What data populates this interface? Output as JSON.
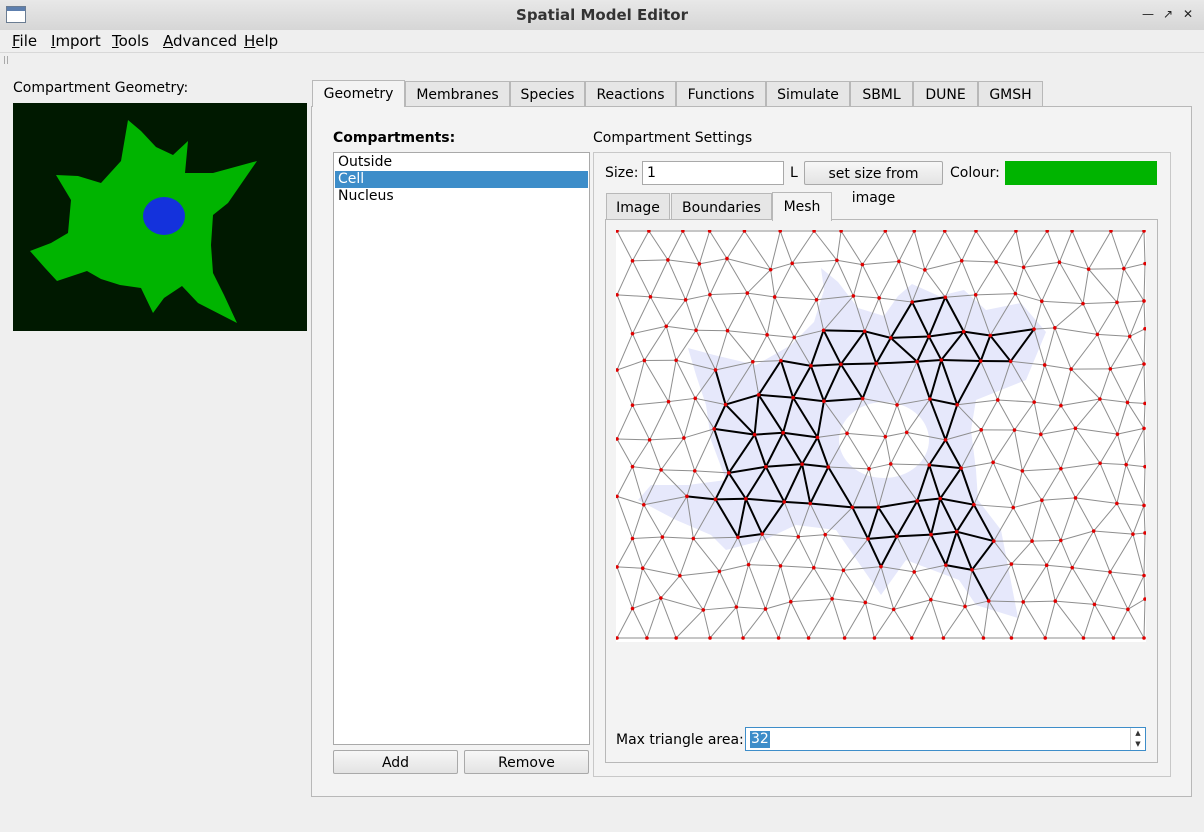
{
  "window": {
    "title": "Spatial Model Editor"
  },
  "menu": [
    "File",
    "Import",
    "Tools",
    "Advanced",
    "Help"
  ],
  "left": {
    "geometry_label": "Compartment Geometry:"
  },
  "tabs": [
    "Geometry",
    "Membranes",
    "Species",
    "Reactions",
    "Functions",
    "Simulate",
    "SBML",
    "DUNE",
    "GMSH"
  ],
  "active_tab": "Geometry",
  "compartments": {
    "label": "Compartments:",
    "items": [
      "Outside",
      "Cell",
      "Nucleus"
    ],
    "selected": "Cell",
    "add_label": "Add",
    "remove_label": "Remove"
  },
  "settings": {
    "title": "Compartment Settings",
    "size_label": "Size:",
    "size_value": "1",
    "size_unit": "L",
    "set_size_button": "set size from image",
    "colour_label": "Colour:",
    "colour": "#00b400",
    "subtabs": [
      "Image",
      "Boundaries",
      "Mesh"
    ],
    "active_subtab": "Mesh",
    "max_area_label": "Max triangle area:",
    "max_area_value": "32"
  },
  "colors": {
    "outside": "#001900",
    "cell": "#00b400",
    "nucleus": "#1432dc",
    "selection": "#3d8dc9",
    "mesh_vertex": "#e00000"
  }
}
